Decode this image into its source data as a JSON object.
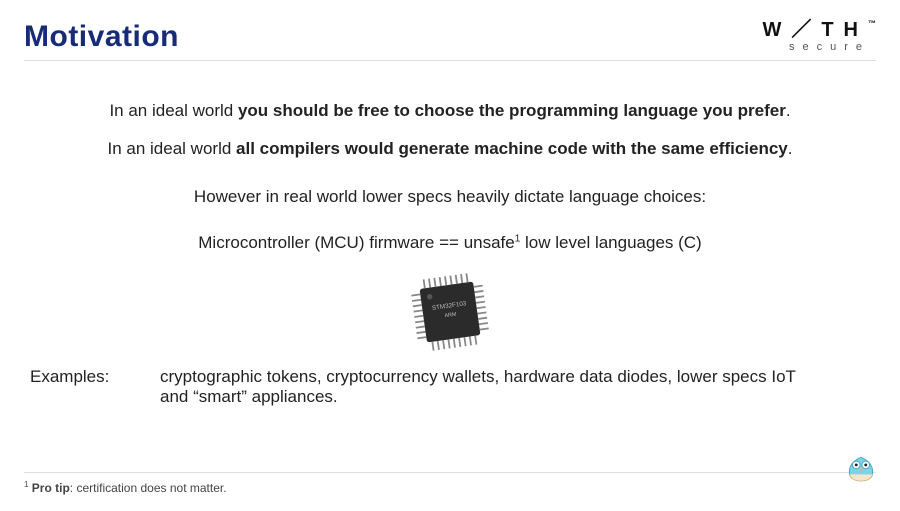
{
  "title": "Motivation",
  "logo": {
    "main": "W／TH",
    "tm": "™",
    "sub": "secure"
  },
  "ideal1": {
    "prefix": "In an ideal world ",
    "bold": "you should be free to choose the programming language you prefer",
    "suffix": "."
  },
  "ideal2": {
    "prefix": "In an ideal world ",
    "bold": "all compilers would generate machine code with the same efficiency",
    "suffix": "."
  },
  "real": "However in real world lower specs heavily dictate language choices:",
  "mcu": {
    "left": "Microcontroller (MCU) firmware  ==  unsafe",
    "sup": "1",
    "right": " low level languages (C)"
  },
  "examples": {
    "label": "Examples:",
    "text": "cryptographic tokens, cryptocurrency wallets, hardware data diodes, lower specs IoT and “smart” appliances."
  },
  "footnote": {
    "sup": "1",
    "label": " Pro tip",
    "text": ": certification does not matter."
  }
}
